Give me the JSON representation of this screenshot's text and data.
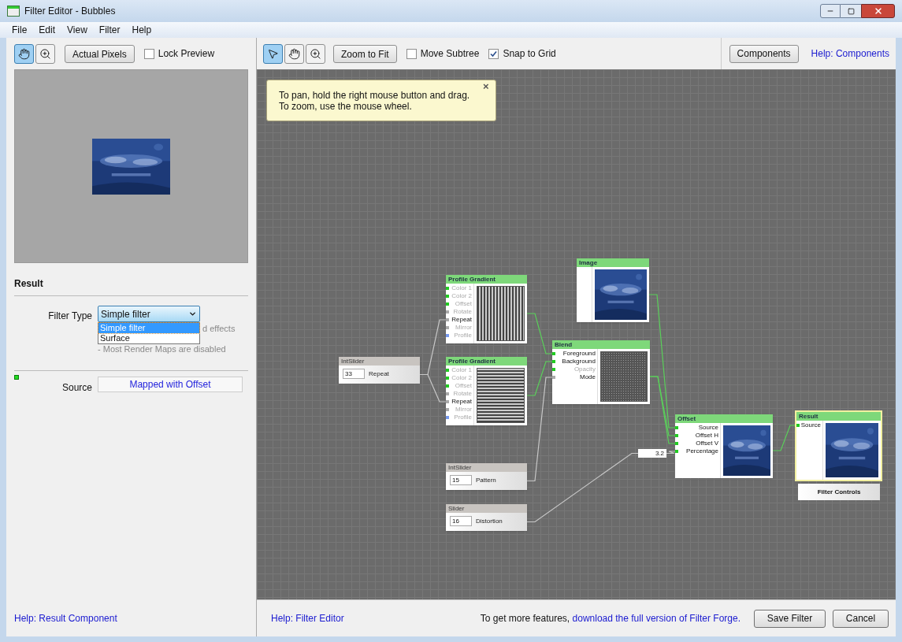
{
  "window": {
    "title": "Filter Editor - Bubbles"
  },
  "menu": [
    "File",
    "Edit",
    "View",
    "Filter",
    "Help"
  ],
  "preview_toolbar": {
    "tools": [
      {
        "kind": "hand",
        "selected": true
      },
      {
        "kind": "zoom",
        "selected": false
      }
    ],
    "actual_pixels": "Actual Pixels",
    "lock_preview": {
      "label": "Lock Preview",
      "checked": false
    }
  },
  "result_panel": {
    "heading": "Result",
    "filter_type_label": "Filter Type",
    "filter_type_value": "Simple filter",
    "dropdown_options": [
      {
        "label": "Simple filter",
        "selected": true
      },
      {
        "label": "Surface",
        "selected": false
      }
    ],
    "notes": [
      "d effects",
      "- Most Render Maps are disabled"
    ],
    "source_label": "Source",
    "source_value": "Mapped with Offset",
    "help_link": "Help: Result Component"
  },
  "graph_toolbar": {
    "tools": [
      {
        "kind": "pointer",
        "selected": true
      },
      {
        "kind": "hand",
        "selected": false
      },
      {
        "kind": "zoom",
        "selected": false
      }
    ],
    "zoom_to_fit": "Zoom to Fit",
    "move_subtree": {
      "label": "Move Subtree",
      "checked": false
    },
    "snap_to_grid": {
      "label": "Snap to Grid",
      "checked": true
    },
    "components": "Components",
    "help_link": "Help: Components"
  },
  "tip": {
    "lines": [
      "To pan, hold the right mouse button and drag.",
      "To zoom, use the mouse wheel."
    ],
    "close": "×"
  },
  "nodes": [
    {
      "kind": "slider",
      "title": "IntSlider",
      "value": "33",
      "label": "Repeat",
      "highlighted": false
    },
    {
      "kind": "component",
      "title": "Profile Gradient",
      "preview": {
        "kind": "vstripes"
      },
      "highlighted": false,
      "ports": [
        {
          "label": "Color 1",
          "connected": false,
          "color": "#22cc22"
        },
        {
          "label": "Color 2",
          "connected": false,
          "color": "#22cc22"
        },
        {
          "label": "Offset",
          "connected": false,
          "color": "#22cc22"
        },
        {
          "label": "Rotate",
          "connected": false,
          "color": "#aaaaaa"
        },
        {
          "label": "Repeat",
          "connected": true,
          "color": "#aaaaaa"
        },
        {
          "label": "Mirror",
          "connected": false,
          "color": "#aaaaaa"
        },
        {
          "label": "Profile",
          "connected": false,
          "color": "#7799ee"
        }
      ]
    },
    {
      "kind": "component",
      "title": "Profile Gradient",
      "preview": {
        "kind": "hstripes"
      },
      "highlighted": false,
      "ports": [
        {
          "label": "Color 1",
          "connected": false,
          "color": "#22cc22"
        },
        {
          "label": "Color 2",
          "connected": false,
          "color": "#22cc22"
        },
        {
          "label": "Offset",
          "connected": false,
          "color": "#22cc22"
        },
        {
          "label": "Rotate",
          "connected": false,
          "color": "#aaaaaa"
        },
        {
          "label": "Repeat",
          "connected": true,
          "color": "#aaaaaa"
        },
        {
          "label": "Mirror",
          "connected": false,
          "color": "#aaaaaa"
        },
        {
          "label": "Profile",
          "connected": false,
          "color": "#7799ee"
        }
      ]
    },
    {
      "kind": "component",
      "title": "Image",
      "preview": {
        "kind": "picture"
      },
      "highlighted": false
    },
    {
      "kind": "component",
      "title": "Blend",
      "preview": {
        "kind": "dots"
      },
      "highlighted": false,
      "ports": [
        {
          "label": "Foreground",
          "connected": true,
          "color": "#22cc22"
        },
        {
          "label": "Background",
          "connected": true,
          "color": "#22cc22"
        },
        {
          "label": "Opacity",
          "connected": false,
          "color": "#22cc22"
        },
        {
          "label": "Mode",
          "connected": true,
          "color": "#aaaaaa"
        }
      ]
    },
    {
      "kind": "slider",
      "title": "IntSlider",
      "value": "15",
      "label": "Pattern",
      "highlighted": false
    },
    {
      "kind": "slider",
      "title": "Slider",
      "value": "16",
      "label": "Distortion",
      "highlighted": false
    },
    {
      "kind": "component",
      "title": "Offset",
      "preview": {
        "kind": "picture"
      },
      "highlighted": false,
      "ports": [
        {
          "label": "Source",
          "connected": true,
          "color": "#22cc22"
        },
        {
          "label": "Offset H",
          "connected": true,
          "color": "#22cc22"
        },
        {
          "label": "Offset V",
          "connected": true,
          "color": "#22cc22"
        },
        {
          "label": "Percentage",
          "connected": true,
          "color": "#22cc22"
        }
      ]
    },
    {
      "kind": "component",
      "title": "Result",
      "preview": {
        "kind": "picture"
      },
      "highlighted": true,
      "ports": [
        {
          "label": "Source",
          "connected": true,
          "color": "#22cc22"
        }
      ]
    }
  ],
  "value_box": "3.2",
  "filter_controls": "Filter Controls",
  "bottom_bar": {
    "help_link": "Help: Filter Editor",
    "promo": "To get more features, ",
    "promo_link": "download the full version of Filter Forge.",
    "save": "Save Filter",
    "cancel": "Cancel"
  }
}
